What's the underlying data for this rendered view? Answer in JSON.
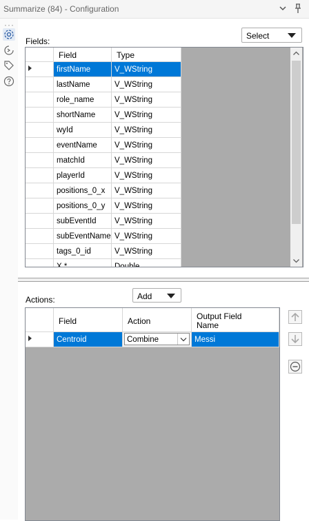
{
  "window": {
    "title": "Summarize (84) - Configuration"
  },
  "fields_section": {
    "label": "Fields:",
    "select_dropdown": "Select",
    "columns": [
      "Field",
      "Type"
    ],
    "rows": [
      {
        "field": "firstName",
        "type": "V_WString"
      },
      {
        "field": "lastName",
        "type": "V_WString"
      },
      {
        "field": "role_name",
        "type": "V_WString"
      },
      {
        "field": "shortName",
        "type": "V_WString"
      },
      {
        "field": "wyId",
        "type": "V_WString"
      },
      {
        "field": "eventName",
        "type": "V_WString"
      },
      {
        "field": "matchId",
        "type": "V_WString"
      },
      {
        "field": "playerId",
        "type": "V_WString"
      },
      {
        "field": "positions_0_x",
        "type": "V_WString"
      },
      {
        "field": "positions_0_y",
        "type": "V_WString"
      },
      {
        "field": "subEventId",
        "type": "V_WString"
      },
      {
        "field": "subEventName",
        "type": "V_WString"
      },
      {
        "field": "tags_0_id",
        "type": "V_WString"
      },
      {
        "field": "X *",
        "type": "Double"
      }
    ]
  },
  "actions_section": {
    "label": "Actions:",
    "add_dropdown": "Add",
    "columns": {
      "field": "Field",
      "action": "Action",
      "output_line1": "Output Field",
      "output_line2": "Name"
    },
    "rows": [
      {
        "field": "Centroid",
        "action": "Combine",
        "output": "Messi"
      }
    ]
  },
  "colors": {
    "selection": "#0078d7",
    "grid_background": "#ababab"
  },
  "icons": {
    "collapse": "chevron-down-icon",
    "pin": "pin-icon",
    "settings": "gear-icon",
    "connection": "arrow-cycle-icon",
    "tag": "tag-icon",
    "help": "question-icon",
    "move_up": "arrow-up-icon",
    "move_down": "arrow-down-icon",
    "remove": "minus-circle-icon"
  }
}
